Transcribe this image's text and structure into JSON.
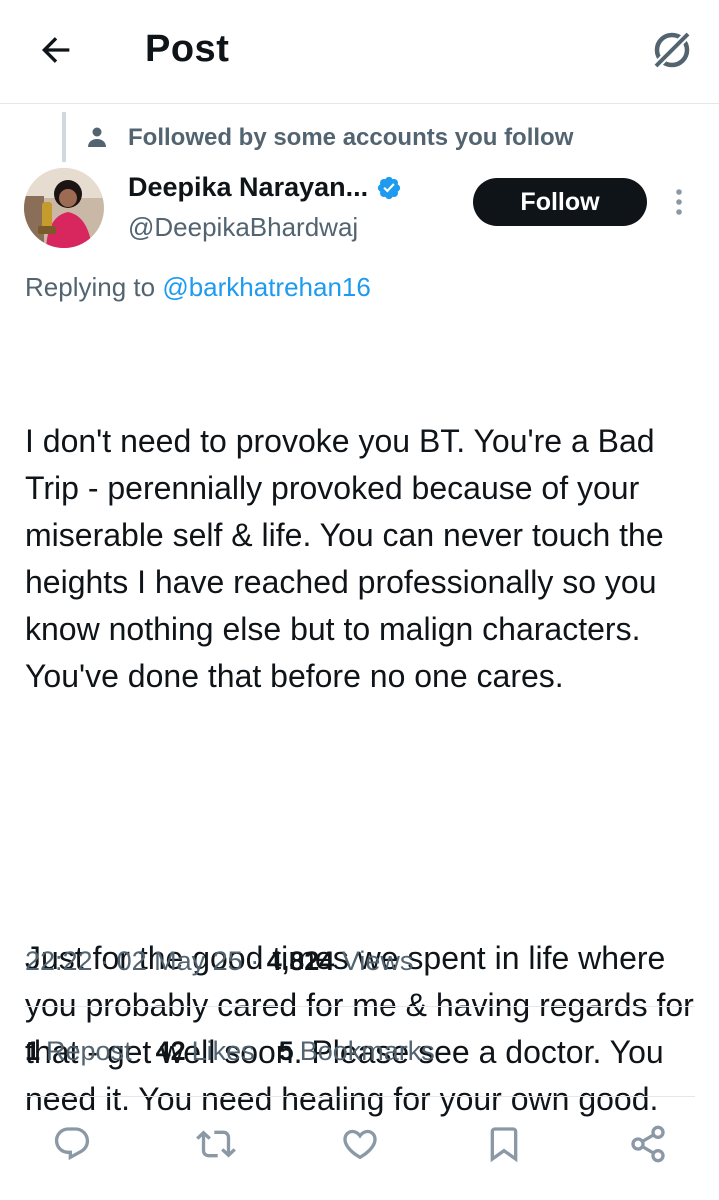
{
  "header": {
    "title": "Post"
  },
  "social_context": {
    "text": "Followed by some accounts you follow"
  },
  "author": {
    "display_name": "Deepika Narayan...",
    "handle": "@DeepikaBhardwaj",
    "verified": true,
    "follow_label": "Follow"
  },
  "reply": {
    "prefix": "Replying to",
    "handle": "@barkhatrehan16"
  },
  "post": {
    "paragraphs": [
      "I don't need to provoke you BT. You're a Bad Trip - perennially provoked because of your miserable self & life. You can never touch the heights I have reached professionally so you know nothing else but to malign characters. You've done that before no one cares.",
      "Just for the good times we spent in life where you probably cared for me & having regards for that - get well soon. Please see a doctor. You need it. You need healing for your own good."
    ]
  },
  "meta": {
    "time": "22:22",
    "separator": "·",
    "date": "02 May 25",
    "views_count": "4,824",
    "views_label": "Views"
  },
  "stats": {
    "reposts_count": "1",
    "reposts_label": "Repost",
    "likes_count": "42",
    "likes_label": "Likes",
    "bookmarks_count": "5",
    "bookmarks_label": "Bookmarks"
  },
  "icons": {
    "back": "arrow-left-icon",
    "grok": "grok-icon",
    "social": "person-icon",
    "verified": "verified-badge-icon",
    "more": "more-vertical-icon",
    "reply": "reply-icon",
    "repost": "repost-icon",
    "like": "heart-icon",
    "bookmark": "bookmark-icon",
    "share": "share-icon"
  },
  "colors": {
    "accent": "#1d9bf0",
    "text": "#0f1419",
    "secondary": "#536471",
    "border": "#e3e7ea",
    "button_bg": "#0f1419"
  }
}
